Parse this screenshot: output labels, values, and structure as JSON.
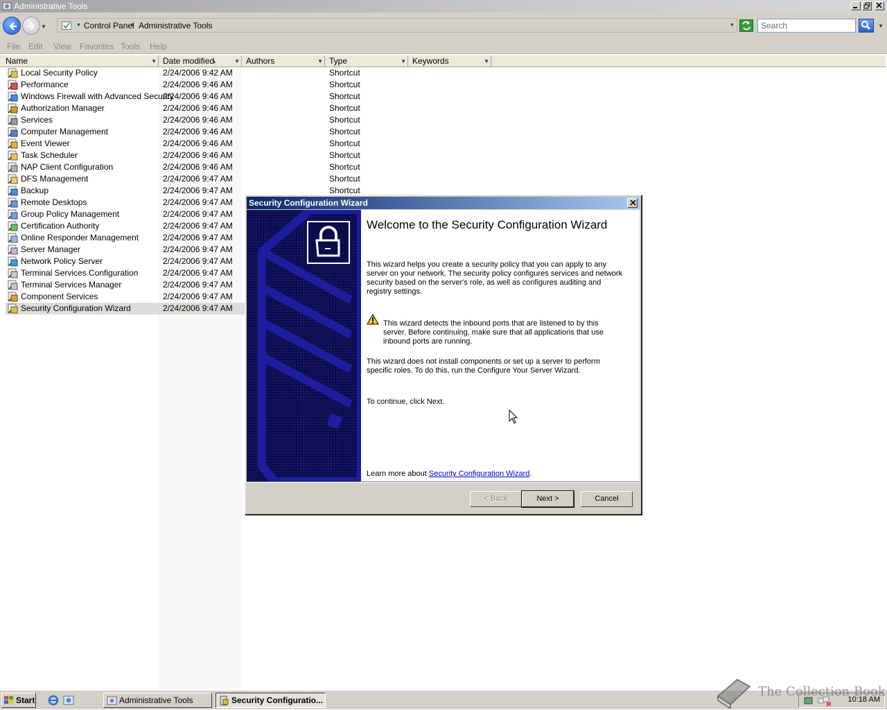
{
  "window": {
    "title": "Administrative Tools"
  },
  "address": {
    "segments": [
      "Control Panel",
      "Administrative Tools"
    ],
    "search_placeholder": "Search"
  },
  "menu": [
    "File",
    "Edit",
    "View",
    "Favorites",
    "Tools",
    "Help"
  ],
  "columns": [
    "Name",
    "Date modified",
    "Authors",
    "Type",
    "Keywords"
  ],
  "files": [
    {
      "name": "Local Security Policy",
      "date": "2/24/2006 9:42 AM",
      "type": "Shortcut",
      "icon": "security-policy-icon"
    },
    {
      "name": "Performance",
      "date": "2/24/2006 9:46 AM",
      "type": "Shortcut",
      "icon": "performance-icon"
    },
    {
      "name": "Windows Firewall with Advanced Security",
      "date": "2/24/2006 9:46 AM",
      "type": "Shortcut",
      "icon": "firewall-icon"
    },
    {
      "name": "Authorization Manager",
      "date": "2/24/2006 9:46 AM",
      "type": "Shortcut",
      "icon": "authorization-icon"
    },
    {
      "name": "Services",
      "date": "2/24/2006 9:46 AM",
      "type": "Shortcut",
      "icon": "services-icon"
    },
    {
      "name": "Computer Management",
      "date": "2/24/2006 9:46 AM",
      "type": "Shortcut",
      "icon": "computer-management-icon"
    },
    {
      "name": "Event Viewer",
      "date": "2/24/2006 9:46 AM",
      "type": "Shortcut",
      "icon": "event-viewer-icon"
    },
    {
      "name": "Task Scheduler",
      "date": "2/24/2006 9:46 AM",
      "type": "Shortcut",
      "icon": "task-scheduler-icon"
    },
    {
      "name": "NAP Client Configuration",
      "date": "2/24/2006 9:46 AM",
      "type": "Shortcut",
      "icon": "nap-icon"
    },
    {
      "name": "DFS Management",
      "date": "2/24/2006 9:47 AM",
      "type": "Shortcut",
      "icon": "dfs-icon"
    },
    {
      "name": "Backup",
      "date": "2/24/2006 9:47 AM",
      "type": "Shortcut",
      "icon": "backup-icon"
    },
    {
      "name": "Remote Desktops",
      "date": "2/24/2006 9:47 AM",
      "type": "",
      "icon": "remote-desktops-icon"
    },
    {
      "name": "Group Policy Management",
      "date": "2/24/2006 9:47 AM",
      "type": "",
      "icon": "group-policy-icon"
    },
    {
      "name": "Certification Authority",
      "date": "2/24/2006 9:47 AM",
      "type": "",
      "icon": "certificate-icon"
    },
    {
      "name": "Online Responder Management",
      "date": "2/24/2006 9:47 AM",
      "type": "",
      "icon": "online-responder-icon"
    },
    {
      "name": "Server Manager",
      "date": "2/24/2006 9:47 AM",
      "type": "",
      "icon": "server-manager-icon"
    },
    {
      "name": "Network Policy Server",
      "date": "2/24/2006 9:47 AM",
      "type": "",
      "icon": "network-policy-icon"
    },
    {
      "name": "Terminal Services Configuration",
      "date": "2/24/2006 9:47 AM",
      "type": "",
      "icon": "terminal-config-icon"
    },
    {
      "name": "Terminal Services Manager",
      "date": "2/24/2006 9:47 AM",
      "type": "",
      "icon": "terminal-manager-icon"
    },
    {
      "name": "Component Services",
      "date": "2/24/2006 9:47 AM",
      "type": "",
      "icon": "component-services-icon"
    },
    {
      "name": "Security Configuration Wizard",
      "date": "2/24/2006 9:47 AM",
      "type": "",
      "icon": "security-wizard-icon",
      "selected": true
    }
  ],
  "dialog": {
    "title": "Security Configuration Wizard",
    "heading": "Welcome to the Security Configuration Wizard",
    "para1": "This wizard helps you create a security policy that you can apply to any server on your network. The security policy configures services and network security based on the server's role, as well as configures auditing and registry settings.",
    "warning": "This wizard detects the inbound ports that are listened to by this server. Before continuing, make sure that all applications that use inbound ports are running.",
    "para3": "This wizard does not install components or set up a server to perform specific roles. To do this, run the Configure Your Server Wizard.",
    "para4": "To continue, click Next.",
    "learn_prefix": "Learn more about ",
    "learn_link": "Security Configuration Wizard",
    "learn_suffix": ".",
    "back_label": "< Back",
    "next_label": "Next >",
    "cancel_label": "Cancel"
  },
  "taskbar": {
    "start_label": "Start",
    "tasks": [
      "Administrative Tools",
      "Security Configuratio..."
    ],
    "clock": "10:18 AM"
  },
  "watermark": "The Collection Book"
}
